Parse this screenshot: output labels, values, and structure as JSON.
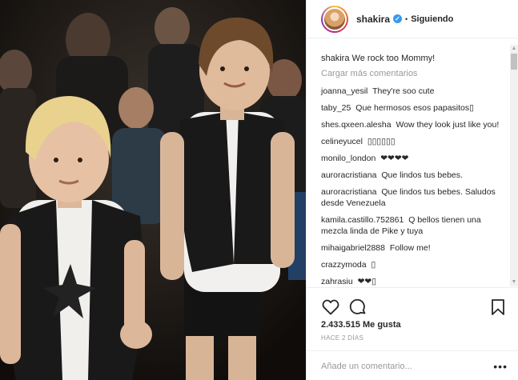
{
  "header": {
    "username": "shakira",
    "verified_mark": "✓",
    "separator": "•",
    "follow_status": "Siguiendo"
  },
  "caption": {
    "user": "shakira",
    "text": "We rock too Mommy!"
  },
  "load_more": "Cargar más comentarios",
  "comments": [
    {
      "user": "joanna_yesil",
      "text": "They're soo cute"
    },
    {
      "user": "taby_25",
      "text": "Que hermosos esos papasitos▯"
    },
    {
      "user": "shes.qxeen.alesha",
      "text": "Wow they look just like you!"
    },
    {
      "user": "celineyucel",
      "text": "▯▯▯▯▯▯"
    },
    {
      "user": "monilo_london",
      "text": "❤❤❤❤"
    },
    {
      "user": "auroracristiana",
      "text": "Que lindos tus bebes."
    },
    {
      "user": "auroracristiana",
      "text": "Que lindos tus bebes. Saludos desde Venezuela"
    },
    {
      "user": "kamila.castillo.752861",
      "text": "Q bellos tienen una mezcla linda de Pike y tuya"
    },
    {
      "user": "mihaigabriel2888",
      "text": "Follow me!"
    },
    {
      "user": "crazzymoda",
      "text": "▯"
    },
    {
      "user": "zahrasiu",
      "text": "❤❤▯"
    }
  ],
  "likes": "2.433.515 Me gusta",
  "time_ago": "HACE 2 DÍAS",
  "add_comment": {
    "placeholder": "Añade un comentario..."
  },
  "more_options": "•••",
  "icons": {
    "like": "heart-icon",
    "comment": "comment-icon",
    "save": "bookmark-icon",
    "scroll_up": "▲",
    "scroll_down": "▼"
  },
  "colors": {
    "accent": "#3897f0",
    "text": "#262626",
    "muted": "#999999",
    "border": "#efefef"
  }
}
